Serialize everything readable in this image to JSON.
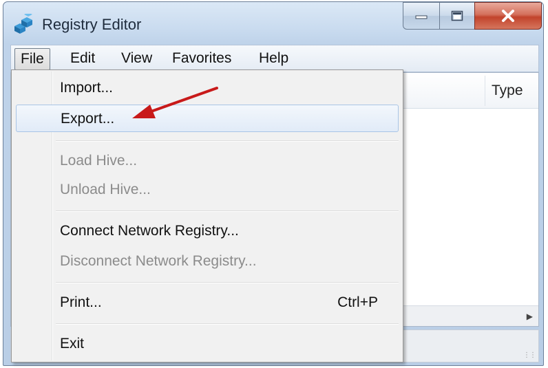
{
  "window": {
    "title": "Registry Editor",
    "icon": "registry-cubes-icon",
    "controls": {
      "minimize": "minimize-icon",
      "maximize": "maximize-icon",
      "close": "close-icon"
    }
  },
  "menubar": {
    "items": [
      {
        "label": "File"
      },
      {
        "label": "Edit"
      },
      {
        "label": "View"
      },
      {
        "label": "Favorites"
      },
      {
        "label": "Help"
      }
    ]
  },
  "content": {
    "columns": [
      "Type"
    ]
  },
  "file_menu": {
    "items": [
      {
        "label": "Import...",
        "enabled": true
      },
      {
        "label": "Export...",
        "enabled": true,
        "highlighted": true
      },
      {
        "label": "Load Hive...",
        "enabled": false
      },
      {
        "label": "Unload Hive...",
        "enabled": false
      },
      {
        "label": "Connect Network Registry...",
        "enabled": true
      },
      {
        "label": "Disconnect Network Registry...",
        "enabled": false
      },
      {
        "label": "Print...",
        "enabled": true,
        "shortcut": "Ctrl+P"
      },
      {
        "label": "Exit",
        "enabled": true
      }
    ]
  },
  "annotation": {
    "icon": "red-arrow-icon",
    "color": "#c81a1a"
  },
  "colors": {
    "highlight_border": "#a8c4e6",
    "close_button": "#c2432c",
    "disabled_text": "#8b8b8b"
  }
}
